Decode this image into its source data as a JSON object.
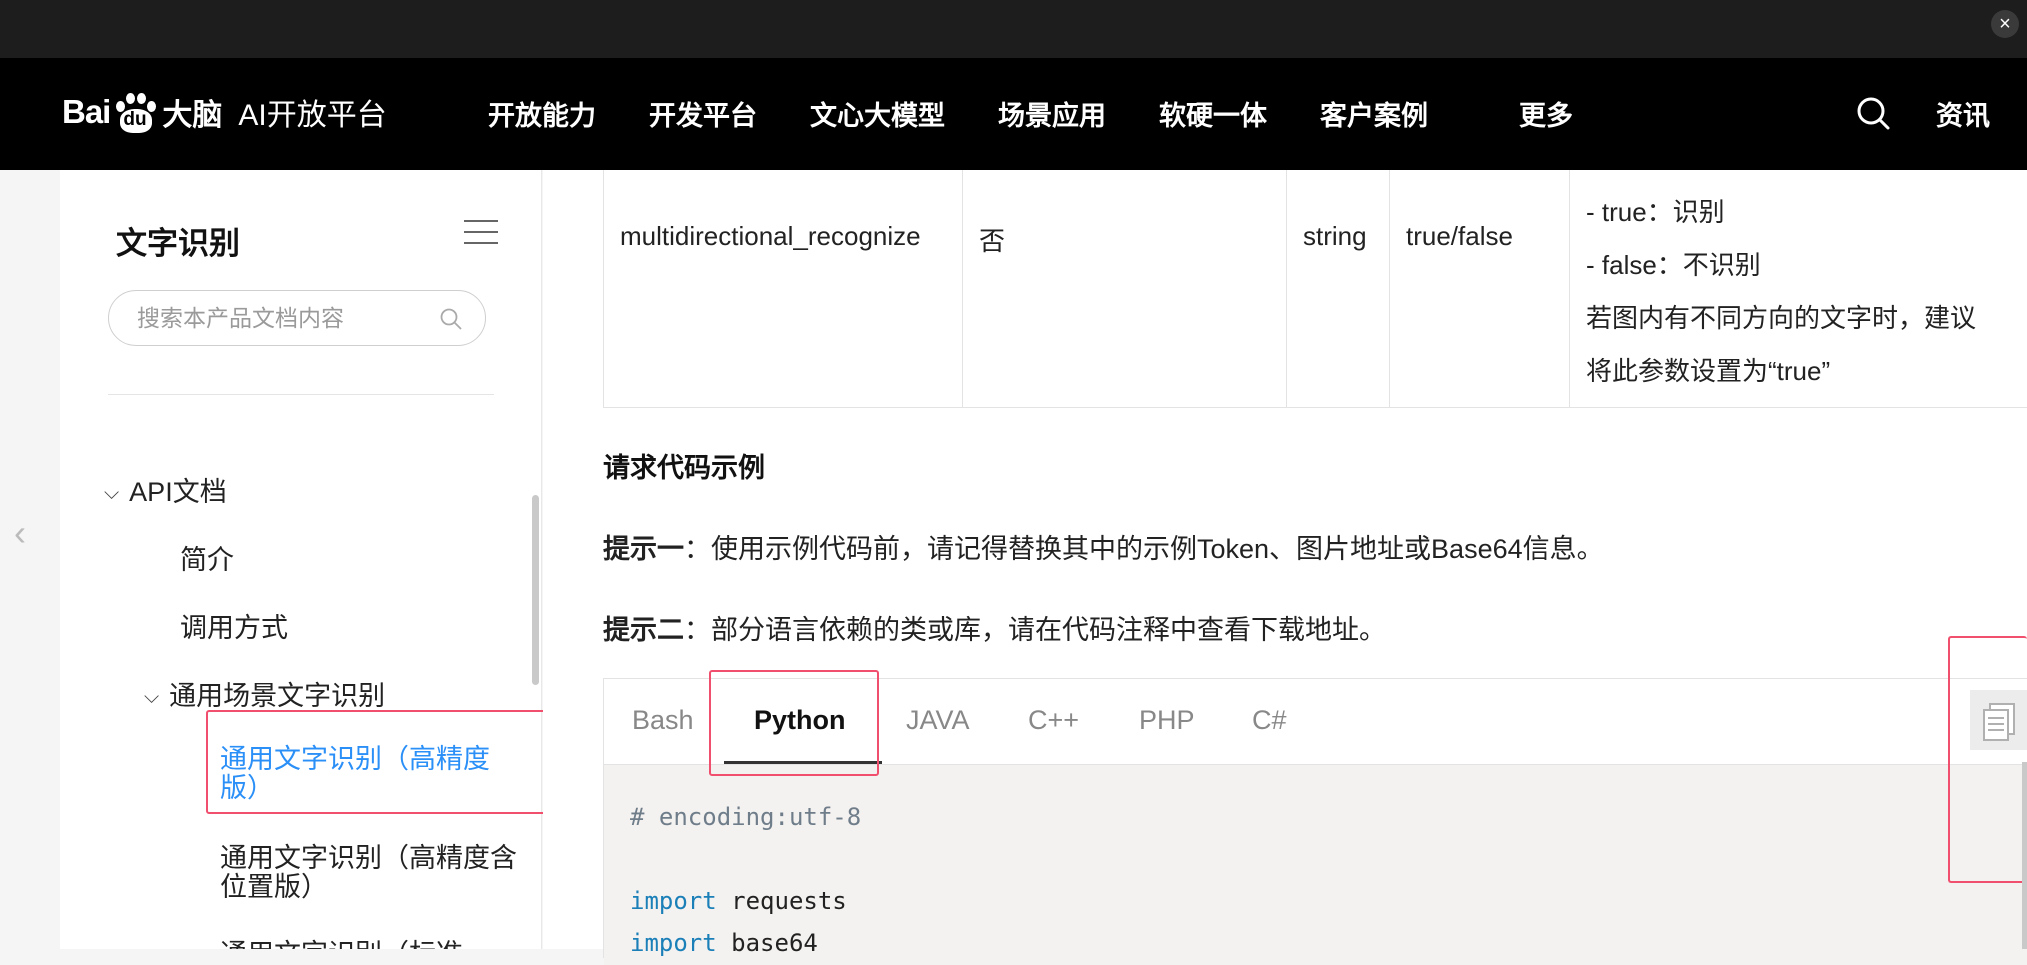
{
  "window": {
    "close_label": "×"
  },
  "nav": {
    "logo": {
      "bai": "Bai",
      "du": "du",
      "brain": "大脑",
      "sub": "AI开放平台"
    },
    "items": [
      "开放能力",
      "开发平台",
      "文心大模型",
      "场景应用",
      "软硬一体",
      "客户案例",
      "更多"
    ],
    "news": "资讯"
  },
  "sidebar": {
    "title": "文字识别",
    "search_placeholder": "搜索本产品文档内容",
    "tree": [
      {
        "label": "API文档",
        "expanded": true
      },
      {
        "label": "简介"
      },
      {
        "label": "调用方式"
      },
      {
        "label": "通用场景文字识别",
        "expanded": true
      },
      {
        "label": "通用文字识别（高精度版）",
        "active": true
      },
      {
        "label": "通用文字识别（高精度含位置版）"
      },
      {
        "label": "通用文字识别（标准"
      }
    ]
  },
  "param_row": {
    "name": "multidirectional_recognize",
    "required": "否",
    "type": "string",
    "values": "true/false",
    "desc": [
      "- true：识别",
      "- false：不识别",
      "若图内有不同方向的文字时，建议",
      "将此参数设置为“true”"
    ]
  },
  "section": {
    "title": "请求代码示例",
    "tip1_label": "提示一",
    "tip1_text": "：使用示例代码前，请记得替换其中的示例Token、图片地址或Base64信息。",
    "tip2_label": "提示二",
    "tip2_text": "：部分语言依赖的类或库，请在代码注释中查看下载地址。"
  },
  "code": {
    "tabs": [
      "Bash",
      "Python",
      "JAVA",
      "C++",
      "PHP",
      "C#"
    ],
    "active_tab": "Python",
    "lines": {
      "l1": "# encoding:utf-8",
      "l2_kw": "import",
      "l2_id": " requests",
      "l3_kw": "import",
      "l3_id": " base64"
    }
  },
  "colors": {
    "active_link": "#2a8ff7",
    "highlight_box": "#f0506e",
    "nav_bg": "#000000"
  }
}
